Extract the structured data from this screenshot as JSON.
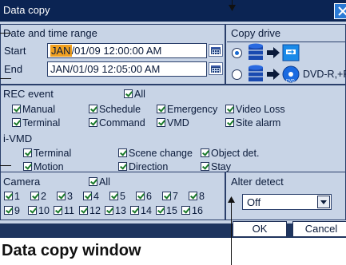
{
  "window": {
    "title": "Data copy"
  },
  "date_range": {
    "title": "Date and time range",
    "start_label": "Start",
    "start_month": "JAN",
    "start_rest": "/01/09 12:00:00 AM",
    "end_label": "End",
    "end_value": "JAN/01/09 12:05:00 AM"
  },
  "copy_drive": {
    "title": "Copy drive",
    "option2_label": "DVD-R,+R"
  },
  "rec_event": {
    "title": "REC event",
    "all": "All",
    "items": [
      "Manual",
      "Schedule",
      "Emergency",
      "Video Loss",
      "Terminal",
      "Command",
      "VMD",
      "Site alarm"
    ]
  },
  "ivmd": {
    "title": "i-VMD",
    "items": [
      "Terminal",
      "Scene change",
      "Object det.",
      "Motion",
      "Direction",
      "Stay"
    ]
  },
  "camera": {
    "title": "Camera",
    "all": "All",
    "items": [
      "1",
      "2",
      "3",
      "4",
      "5",
      "6",
      "7",
      "8",
      "9",
      "10",
      "11",
      "12",
      "13",
      "14",
      "15",
      "16"
    ]
  },
  "alter_detect": {
    "title": "Alter detect",
    "selected": "Off"
  },
  "buttons": {
    "ok": "OK",
    "cancel": "Cancel"
  },
  "caption": "Data copy window",
  "colors": {
    "titlebar": "#0b2453",
    "panel_bg": "#c8d4e6",
    "footer": "#1e355f",
    "month_highlight": "#f0a020",
    "check": "#1a7a2a"
  }
}
